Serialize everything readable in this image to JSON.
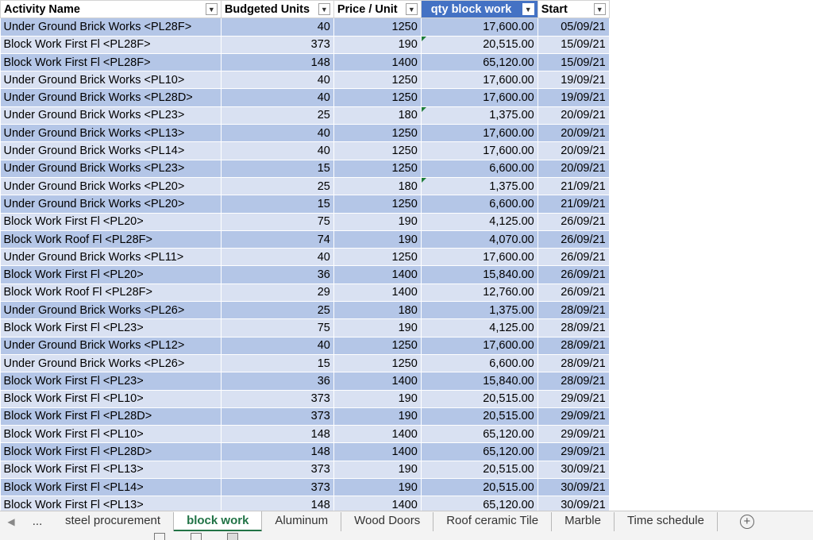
{
  "headers": {
    "activity": "Activity Name",
    "budgeted": "Budgeted Units",
    "price": "Price / Unit",
    "qty": "qty block work",
    "start": "Start"
  },
  "rows": [
    [
      "Under Ground Brick Works  <PL28F>",
      "40",
      "1250",
      "17,600.00",
      "05/09/21"
    ],
    [
      "Block Work First Fl  <PL28F>",
      "373",
      "190",
      "20,515.00",
      "15/09/21"
    ],
    [
      "Block Work First Fl  <PL28F>",
      "148",
      "1400",
      "65,120.00",
      "15/09/21"
    ],
    [
      "Under Ground Brick Works  <PL10>",
      "40",
      "1250",
      "17,600.00",
      "19/09/21"
    ],
    [
      "Under Ground Brick Works  <PL28D>",
      "40",
      "1250",
      "17,600.00",
      "19/09/21"
    ],
    [
      "Under Ground Brick Works  <PL23>",
      "25",
      "180",
      "1,375.00",
      "20/09/21"
    ],
    [
      "Under Ground Brick Works  <PL13>",
      "40",
      "1250",
      "17,600.00",
      "20/09/21"
    ],
    [
      "Under Ground Brick Works  <PL14>",
      "40",
      "1250",
      "17,600.00",
      "20/09/21"
    ],
    [
      "Under Ground Brick Works  <PL23>",
      "15",
      "1250",
      "6,600.00",
      "20/09/21"
    ],
    [
      "Under Ground Brick Works  <PL20>",
      "25",
      "180",
      "1,375.00",
      "21/09/21"
    ],
    [
      "Under Ground Brick Works  <PL20>",
      "15",
      "1250",
      "6,600.00",
      "21/09/21"
    ],
    [
      "Block Work First Fl  <PL20>",
      "75",
      "190",
      "4,125.00",
      "26/09/21"
    ],
    [
      "Block Work Roof Fl  <PL28F>",
      "74",
      "190",
      "4,070.00",
      "26/09/21"
    ],
    [
      "Under Ground Brick Works  <PL11>",
      "40",
      "1250",
      "17,600.00",
      "26/09/21"
    ],
    [
      "Block Work First Fl  <PL20>",
      "36",
      "1400",
      "15,840.00",
      "26/09/21"
    ],
    [
      "Block Work Roof Fl  <PL28F>",
      "29",
      "1400",
      "12,760.00",
      "26/09/21"
    ],
    [
      "Under Ground Brick Works  <PL26>",
      "25",
      "180",
      "1,375.00",
      "28/09/21"
    ],
    [
      "Block Work First Fl  <PL23>",
      "75",
      "190",
      "4,125.00",
      "28/09/21"
    ],
    [
      "Under Ground Brick Works  <PL12>",
      "40",
      "1250",
      "17,600.00",
      "28/09/21"
    ],
    [
      "Under Ground Brick Works  <PL26>",
      "15",
      "1250",
      "6,600.00",
      "28/09/21"
    ],
    [
      "Block Work First Fl  <PL23>",
      "36",
      "1400",
      "15,840.00",
      "28/09/21"
    ],
    [
      "Block Work First Fl  <PL10>",
      "373",
      "190",
      "20,515.00",
      "29/09/21"
    ],
    [
      "Block Work First Fl  <PL28D>",
      "373",
      "190",
      "20,515.00",
      "29/09/21"
    ],
    [
      "Block Work First Fl  <PL10>",
      "148",
      "1400",
      "65,120.00",
      "29/09/21"
    ],
    [
      "Block Work First Fl  <PL28D>",
      "148",
      "1400",
      "65,120.00",
      "29/09/21"
    ],
    [
      "Block Work First Fl  <PL13>",
      "373",
      "190",
      "20,515.00",
      "30/09/21"
    ],
    [
      "Block Work First Fl  <PL14>",
      "373",
      "190",
      "20,515.00",
      "30/09/21"
    ],
    [
      "Block Work First Fl  <PL13>",
      "148",
      "1400",
      "65,120.00",
      "30/09/21"
    ]
  ],
  "price_markers": [
    1,
    5,
    9
  ],
  "tabs": {
    "ellipsis": "...",
    "items": [
      "steel procurement",
      "block work",
      "Aluminum",
      "Wood Doors",
      "Roof ceramic Tile",
      "Marble",
      "Time schedule"
    ],
    "active": "block work",
    "add": "+"
  },
  "icons": {
    "dropdown": "▼",
    "nav_prev": "◀",
    "nav_next": "▶"
  }
}
